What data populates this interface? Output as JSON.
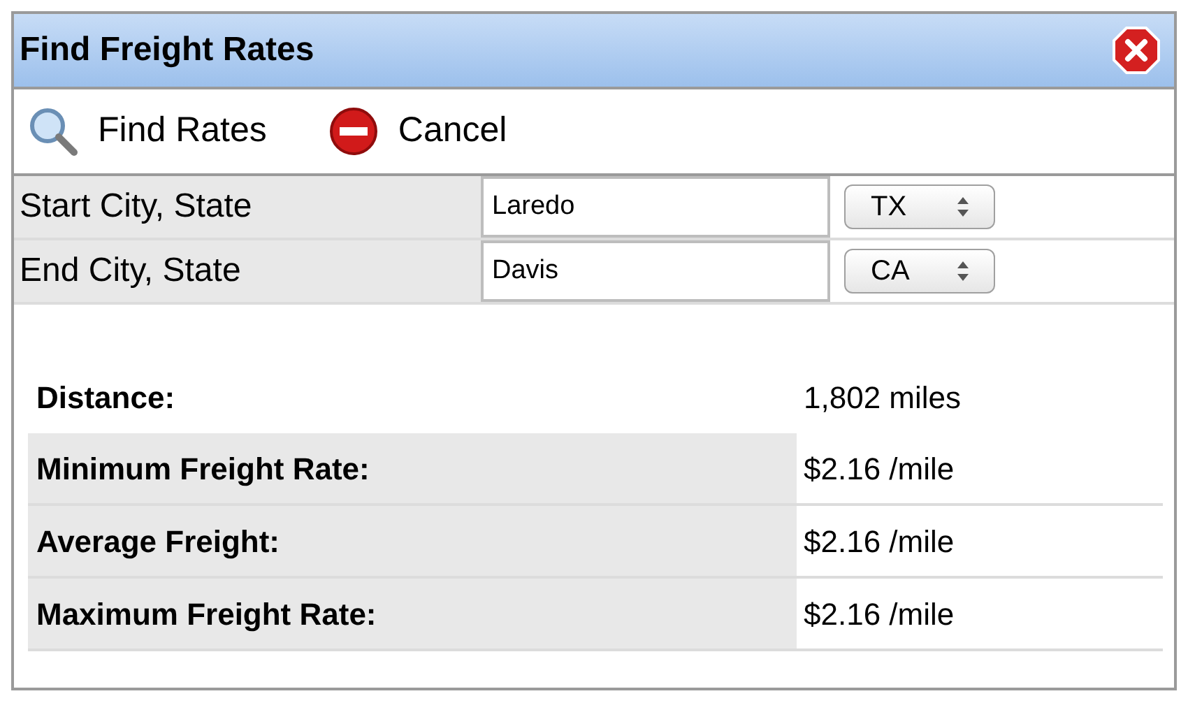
{
  "window": {
    "title": "Find Freight Rates"
  },
  "toolbar": [
    {
      "kind": "search",
      "label": "Find Rates"
    },
    {
      "kind": "cancel",
      "label": "Cancel"
    }
  ],
  "form": [
    {
      "label": "Start City, State",
      "city": "Laredo",
      "state": "TX"
    },
    {
      "label": "End City, State",
      "city": "Davis",
      "state": "CA"
    }
  ],
  "results": [
    {
      "label": "Distance:",
      "value": "1,802 miles"
    },
    {
      "label": "Minimum Freight Rate:",
      "value": "$2.16 /mile"
    },
    {
      "label": "Average Freight:",
      "value": "$2.16 /mile"
    },
    {
      "label": "Maximum Freight Rate:",
      "value": "$2.16 /mile"
    }
  ]
}
